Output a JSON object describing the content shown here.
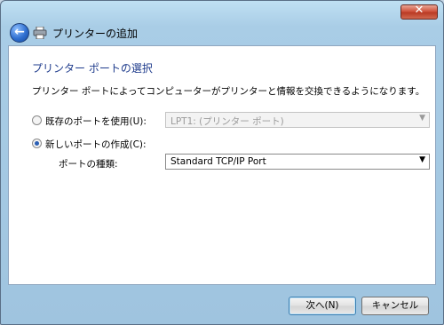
{
  "window": {
    "close_glyph": "✕"
  },
  "header": {
    "title": "プリンターの追加",
    "back_icon": "back-arrow-icon",
    "printer_icon": "printer-icon"
  },
  "page": {
    "section_title": "プリンター ポートの選択",
    "description": "プリンター ポートによってコンピューターがプリンターと情報を交換できるようになります。",
    "existing_port": {
      "label": "既存のポートを使用(U):",
      "selected": false,
      "value": "LPT1: (プリンター ポート)"
    },
    "new_port": {
      "label": "新しいポートの作成(C):",
      "selected": true
    },
    "port_type": {
      "label": "ポートの種類:",
      "value": "Standard TCP/IP Port"
    }
  },
  "footer": {
    "next_label": "次へ(N)",
    "cancel_label": "キャンセル"
  }
}
